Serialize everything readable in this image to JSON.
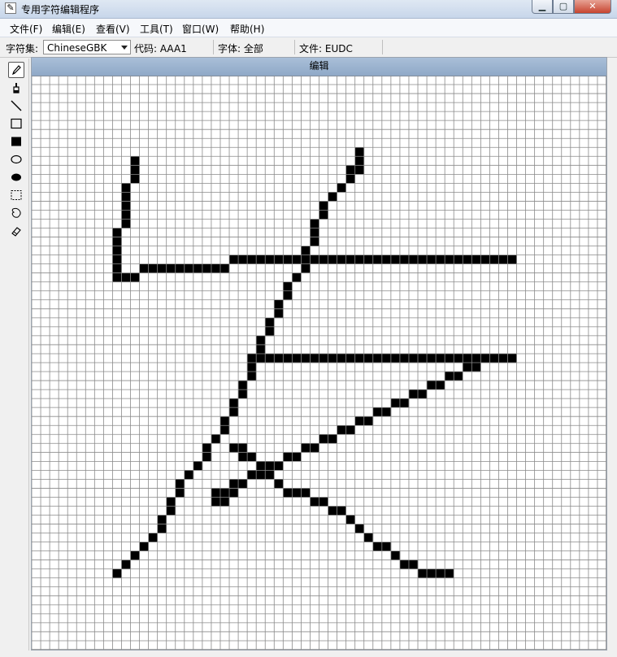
{
  "window": {
    "title": "专用字符编辑程序",
    "app_icon": "pencil-icon",
    "controls": [
      "minimize",
      "maximize",
      "close"
    ]
  },
  "menu": [
    {
      "label": "文件(F)"
    },
    {
      "label": "编辑(E)"
    },
    {
      "label": "查看(V)"
    },
    {
      "label": "工具(T)"
    },
    {
      "label": "窗口(W)"
    },
    {
      "label": "帮助(H)"
    }
  ],
  "infobar": {
    "charset_label": "字符集:",
    "charset_value": "ChineseGBK",
    "code_text": "代码: AAA1",
    "font_text": "字体: 全部",
    "file_text": "文件: EUDC"
  },
  "tools": [
    {
      "icon": "pencil-icon",
      "active": true
    },
    {
      "icon": "brush-icon",
      "active": false
    },
    {
      "icon": "line-icon",
      "active": false
    },
    {
      "icon": "hollow-rectangle-icon",
      "active": false
    },
    {
      "icon": "filled-rectangle-icon",
      "active": false
    },
    {
      "icon": "hollow-ellipse-icon",
      "active": false
    },
    {
      "icon": "filled-ellipse-icon",
      "active": false
    },
    {
      "icon": "rect-select-icon",
      "active": false
    },
    {
      "icon": "freeform-select-icon",
      "active": false
    },
    {
      "icon": "eraser-icon",
      "active": false
    }
  ],
  "editor": {
    "header": "编辑",
    "grid_columns": 64,
    "grid_rows": 64,
    "filled_cells": [
      [
        11,
        9
      ],
      [
        11,
        10
      ],
      [
        11,
        11
      ],
      [
        10,
        12
      ],
      [
        10,
        13
      ],
      [
        10,
        14
      ],
      [
        10,
        15
      ],
      [
        10,
        16
      ],
      [
        9,
        17
      ],
      [
        9,
        18
      ],
      [
        9,
        19
      ],
      [
        9,
        20
      ],
      [
        9,
        21
      ],
      [
        9,
        22
      ],
      [
        10,
        22
      ],
      [
        11,
        22
      ],
      [
        12,
        21
      ],
      [
        13,
        21
      ],
      [
        14,
        21
      ],
      [
        15,
        21
      ],
      [
        16,
        21
      ],
      [
        17,
        21
      ],
      [
        18,
        21
      ],
      [
        19,
        21
      ],
      [
        20,
        21
      ],
      [
        21,
        21
      ],
      [
        22,
        20
      ],
      [
        23,
        20
      ],
      [
        24,
        20
      ],
      [
        25,
        20
      ],
      [
        26,
        20
      ],
      [
        27,
        20
      ],
      [
        28,
        20
      ],
      [
        29,
        20
      ],
      [
        30,
        20
      ],
      [
        31,
        20
      ],
      [
        32,
        20
      ],
      [
        33,
        20
      ],
      [
        34,
        20
      ],
      [
        35,
        20
      ],
      [
        36,
        20
      ],
      [
        37,
        20
      ],
      [
        38,
        20
      ],
      [
        39,
        20
      ],
      [
        40,
        20
      ],
      [
        41,
        20
      ],
      [
        42,
        20
      ],
      [
        43,
        20
      ],
      [
        44,
        20
      ],
      [
        45,
        20
      ],
      [
        46,
        20
      ],
      [
        47,
        20
      ],
      [
        48,
        20
      ],
      [
        49,
        20
      ],
      [
        50,
        20
      ],
      [
        51,
        20
      ],
      [
        52,
        20
      ],
      [
        53,
        20
      ],
      [
        36,
        8
      ],
      [
        36,
        9
      ],
      [
        35,
        10
      ],
      [
        36,
        10
      ],
      [
        35,
        11
      ],
      [
        34,
        12
      ],
      [
        33,
        13
      ],
      [
        32,
        14
      ],
      [
        32,
        15
      ],
      [
        31,
        16
      ],
      [
        31,
        17
      ],
      [
        31,
        18
      ],
      [
        30,
        19
      ],
      [
        30,
        21
      ],
      [
        29,
        22
      ],
      [
        28,
        23
      ],
      [
        28,
        24
      ],
      [
        27,
        25
      ],
      [
        27,
        26
      ],
      [
        26,
        27
      ],
      [
        26,
        28
      ],
      [
        25,
        29
      ],
      [
        25,
        30
      ],
      [
        24,
        31
      ],
      [
        24,
        32
      ],
      [
        24,
        33
      ],
      [
        23,
        34
      ],
      [
        23,
        35
      ],
      [
        22,
        36
      ],
      [
        22,
        37
      ],
      [
        21,
        38
      ],
      [
        21,
        39
      ],
      [
        20,
        40
      ],
      [
        19,
        41
      ],
      [
        19,
        42
      ],
      [
        18,
        43
      ],
      [
        17,
        44
      ],
      [
        16,
        45
      ],
      [
        16,
        46
      ],
      [
        15,
        47
      ],
      [
        15,
        48
      ],
      [
        14,
        49
      ],
      [
        14,
        50
      ],
      [
        13,
        51
      ],
      [
        12,
        52
      ],
      [
        11,
        53
      ],
      [
        10,
        54
      ],
      [
        9,
        55
      ],
      [
        25,
        31
      ],
      [
        26,
        31
      ],
      [
        27,
        31
      ],
      [
        28,
        31
      ],
      [
        29,
        31
      ],
      [
        30,
        31
      ],
      [
        31,
        31
      ],
      [
        32,
        31
      ],
      [
        33,
        31
      ],
      [
        34,
        31
      ],
      [
        35,
        31
      ],
      [
        36,
        31
      ],
      [
        37,
        31
      ],
      [
        38,
        31
      ],
      [
        39,
        31
      ],
      [
        40,
        31
      ],
      [
        41,
        31
      ],
      [
        42,
        31
      ],
      [
        43,
        31
      ],
      [
        44,
        31
      ],
      [
        45,
        31
      ],
      [
        46,
        31
      ],
      [
        47,
        31
      ],
      [
        48,
        31
      ],
      [
        49,
        31
      ],
      [
        50,
        31
      ],
      [
        51,
        31
      ],
      [
        52,
        31
      ],
      [
        53,
        31
      ],
      [
        48,
        32
      ],
      [
        49,
        32
      ],
      [
        46,
        33
      ],
      [
        47,
        33
      ],
      [
        44,
        34
      ],
      [
        45,
        34
      ],
      [
        42,
        35
      ],
      [
        43,
        35
      ],
      [
        40,
        36
      ],
      [
        41,
        36
      ],
      [
        38,
        37
      ],
      [
        39,
        37
      ],
      [
        36,
        38
      ],
      [
        37,
        38
      ],
      [
        34,
        39
      ],
      [
        35,
        39
      ],
      [
        32,
        40
      ],
      [
        33,
        40
      ],
      [
        30,
        41
      ],
      [
        31,
        41
      ],
      [
        28,
        42
      ],
      [
        29,
        42
      ],
      [
        26,
        43
      ],
      [
        27,
        43
      ],
      [
        24,
        44
      ],
      [
        25,
        44
      ],
      [
        22,
        45
      ],
      [
        23,
        45
      ],
      [
        21,
        46
      ],
      [
        22,
        46
      ],
      [
        20,
        46
      ],
      [
        20,
        47
      ],
      [
        21,
        47
      ],
      [
        22,
        41
      ],
      [
        23,
        41
      ],
      [
        23,
        42
      ],
      [
        24,
        42
      ],
      [
        25,
        43
      ],
      [
        26,
        44
      ],
      [
        27,
        45
      ],
      [
        28,
        46
      ],
      [
        29,
        46
      ],
      [
        30,
        46
      ],
      [
        31,
        47
      ],
      [
        32,
        47
      ],
      [
        33,
        48
      ],
      [
        34,
        48
      ],
      [
        35,
        49
      ],
      [
        36,
        50
      ],
      [
        37,
        51
      ],
      [
        38,
        52
      ],
      [
        39,
        52
      ],
      [
        40,
        53
      ],
      [
        41,
        54
      ],
      [
        42,
        54
      ],
      [
        43,
        55
      ],
      [
        44,
        55
      ],
      [
        45,
        55
      ],
      [
        46,
        55
      ]
    ]
  }
}
